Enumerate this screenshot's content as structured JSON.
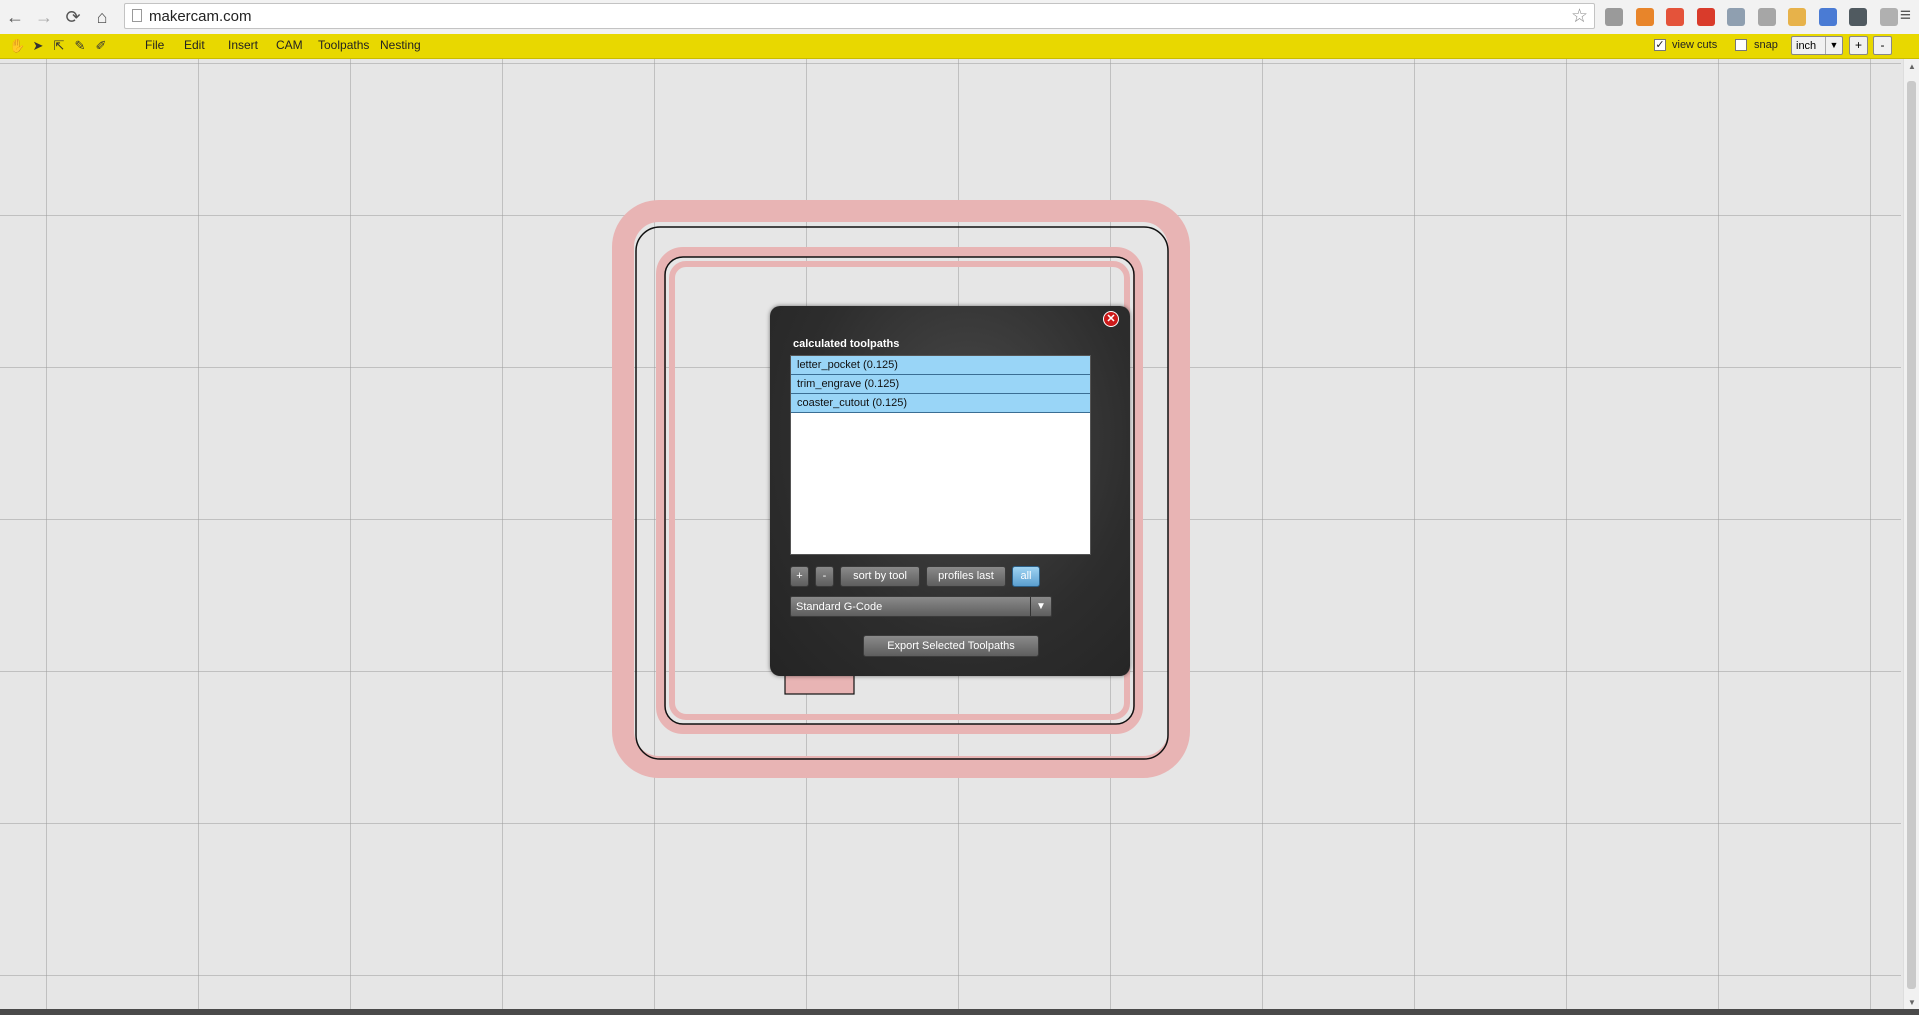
{
  "browser": {
    "back_glyph": "←",
    "forward_glyph": "→",
    "reload_glyph": "⟳",
    "home_glyph": "⌂",
    "url": "makercam.com",
    "star_glyph": "☆",
    "menu_glyph": "≡",
    "extensions": [
      {
        "name": "hourglass-extension-icon",
        "color": "#9a9a9a"
      },
      {
        "name": "chart-extension-icon",
        "color": "#e8852a"
      },
      {
        "name": "plus-extension-icon",
        "color": "#e4533a"
      },
      {
        "name": "rss-extension-icon",
        "color": "#d93b2b"
      },
      {
        "name": "grid-extension-icon",
        "color": "#8f9fb0"
      },
      {
        "name": "dots-extension-icon",
        "color": "#a6a6a6"
      },
      {
        "name": "cookie-extension-icon",
        "color": "#e7b24a"
      },
      {
        "name": "pie-extension-icon",
        "color": "#4a7bd4"
      },
      {
        "name": "monitor-extension-icon",
        "color": "#505a60"
      },
      {
        "name": "camera-extension-icon",
        "color": "#b0b0b0"
      }
    ]
  },
  "appbar": {
    "tools": [
      {
        "name": "hand-tool-icon",
        "glyph": "✋"
      },
      {
        "name": "pointer-tool-icon",
        "glyph": "➤"
      },
      {
        "name": "node-select-tool-icon",
        "glyph": "⇱"
      },
      {
        "name": "pen-tool-icon",
        "glyph": "✎"
      },
      {
        "name": "pencil-tool-icon",
        "glyph": "✐"
      }
    ],
    "menus": [
      "File",
      "Edit",
      "Insert",
      "CAM",
      "Toolpaths",
      "Nesting"
    ],
    "view_cuts_checked": "✓",
    "view_cuts_label": "view cuts",
    "snap_label": "snap",
    "unit_value": "inch",
    "unit_arrow": "▼",
    "zoom_in": "+",
    "zoom_out": "-"
  },
  "scroll": {
    "up": "▲",
    "down": "▼"
  },
  "dialog": {
    "close_glyph": "✕",
    "title": "calculated toolpaths",
    "toolpaths": [
      "letter_pocket (0.125)",
      "trim_engrave (0.125)",
      "coaster_cutout (0.125)"
    ],
    "buttons": {
      "add": "+",
      "remove": "-",
      "sort_by_tool": "sort by tool",
      "profiles_last": "profiles last",
      "all": "all"
    },
    "format_value": "Standard G-Code",
    "format_arrow": "▼",
    "export_label": "Export Selected Toolpaths"
  },
  "colors": {
    "toolbar": "#e8d800",
    "toolpath_pink": "#e8b4b4",
    "selection_blue": "#99d5f7"
  }
}
